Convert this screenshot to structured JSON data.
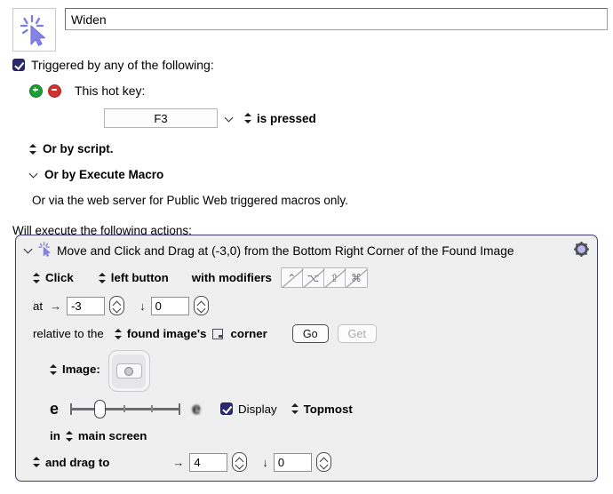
{
  "macro": {
    "icon": "sparkle-cursor-icon",
    "name_value": "Widen",
    "name_placeholder": "Macro Name"
  },
  "trigger": {
    "enabled_label": "Triggered by any of the following:",
    "checked": true,
    "add_button": "add-trigger-button",
    "remove_button": "remove-trigger-button",
    "hot_key_label": "This hot key:",
    "hot_key_value": "F3",
    "hot_key_condition": "is pressed",
    "or_by_script": "Or by script.",
    "or_by_execute_macro": "Or by Execute Macro",
    "web_note": "Or via the web server for Public Web triggered macros only."
  },
  "actions_header": "Will execute the following actions:",
  "action": {
    "title": "Move and Click and Drag at (-3,0) from the Bottom Right Corner of the Found Image",
    "gear": "gear-icon",
    "click_mode": "Click",
    "mouse_button": "left button",
    "modifiers_label": "with modifiers",
    "modifiers": [
      {
        "name": "control",
        "glyph": "⌃",
        "enabled": false
      },
      {
        "name": "option",
        "glyph": "⌥",
        "enabled": false
      },
      {
        "name": "shift",
        "glyph": "⇧",
        "enabled": false
      },
      {
        "name": "command",
        "glyph": "⌘",
        "enabled": false
      }
    ],
    "at_label": "at",
    "at_x_value": "-3",
    "at_y_value": "0",
    "relative_label": "relative to the",
    "relative_target": "found image's",
    "relative_corner": "corner",
    "go_label": "Go",
    "get_label": "Get",
    "image_label": "Image:",
    "image_well": "image-well-thumbnail",
    "fuzz_left_label": "e",
    "fuzz_right_label": "e",
    "display_label": "Display",
    "display_checked": true,
    "topmost_label": "Topmost",
    "screen_prefix": "in",
    "screen_value": "main screen",
    "drag_label": "and drag to",
    "drag_x_value": "4",
    "drag_y_value": "0",
    "arrow_right": "→",
    "arrow_down": "↓"
  },
  "colors": {
    "accent_purple": "#7b7be0",
    "panel_border": "#3b3a78",
    "panel_bg": "#efeff0",
    "checkbox_fill": "#2b2a6e",
    "add_green": "#1d9b34",
    "remove_red": "#d0332f"
  }
}
